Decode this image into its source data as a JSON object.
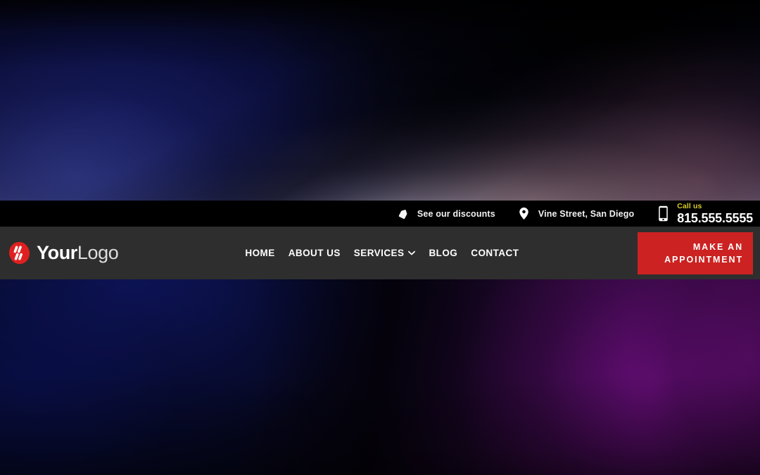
{
  "theme": {
    "topbar_bg": "#000000",
    "navbar_bg": "#2e2e2e",
    "accent_red": "#cc2222",
    "accent_yellow": "#d9cc22",
    "text_white": "#ffffff"
  },
  "topbar": {
    "items": [
      {
        "icon": "tag-icon",
        "label": "See our discounts"
      },
      {
        "icon": "map-pin-icon",
        "label": "Vine Street, San Diego"
      }
    ],
    "phone": {
      "icon": "mobile-phone-icon",
      "call_label": "Call us",
      "number": "815.555.5555"
    }
  },
  "navbar": {
    "brand": {
      "icon": "logo-mark-icon",
      "name_bold": "Your",
      "name_light": "Logo"
    },
    "links": [
      {
        "label": "HOME",
        "has_dropdown": false
      },
      {
        "label": "ABOUT US",
        "has_dropdown": false
      },
      {
        "label": "SERVICES",
        "has_dropdown": true,
        "caret_icon": "chevron-down-icon"
      },
      {
        "label": "BLOG",
        "has_dropdown": false
      },
      {
        "label": "CONTACT",
        "has_dropdown": false
      }
    ],
    "cta": {
      "line1": "MAKE AN",
      "line2": "APPOINTMENT"
    }
  }
}
